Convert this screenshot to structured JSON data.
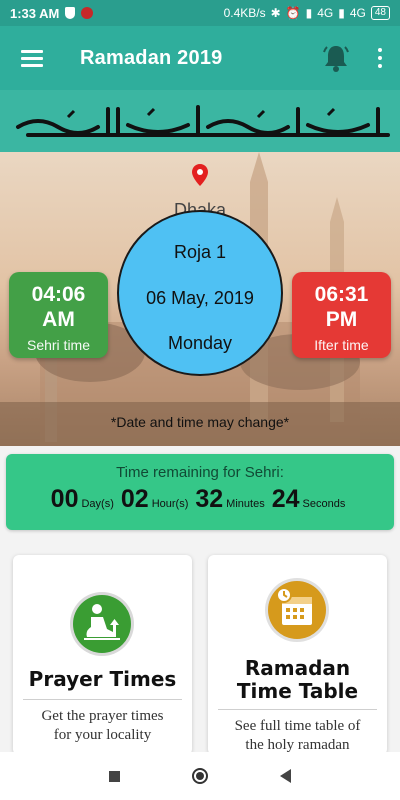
{
  "status_bar": {
    "time": "1:33 AM",
    "network_speed": "0.4KB/s",
    "network_1": "4G",
    "network_2": "4G",
    "battery": "48"
  },
  "app_bar": {
    "title": "Ramadan 2019",
    "icons": [
      "menu-icon",
      "bell-icon",
      "more-vert-icon"
    ]
  },
  "hero": {
    "location": "Dhaka",
    "sehri": {
      "time": "04:06",
      "ampm": "AM",
      "label": "Sehri time"
    },
    "ifter": {
      "time": "06:31",
      "ampm": "PM",
      "label": "Ifter time"
    },
    "date": {
      "roja": "Roja 1",
      "date": "06 May, 2019",
      "day": "Monday"
    },
    "disclaimer": "*Date and time may change*"
  },
  "countdown": {
    "label": "Time remaining for Sehri:",
    "days": "00",
    "days_unit": "Day(s)",
    "hours": "02",
    "hours_unit": "Hour(s)",
    "minutes": "32",
    "minutes_unit": "Minutes",
    "seconds": "24",
    "seconds_unit": "Seconds"
  },
  "cards": [
    {
      "title_1": "Prayer Times",
      "title_2": "",
      "desc_1": "Get the prayer times",
      "desc_2": "for your locality"
    },
    {
      "title_1": "Ramadan",
      "title_2": "Time Table",
      "desc_1": "See full time table of",
      "desc_2": "the holy ramadan"
    }
  ],
  "colors": {
    "primary": "#2fae9c",
    "sehri": "#43a047",
    "ifter": "#e53935",
    "circle": "#4fc1f3",
    "countdown": "#35c788"
  }
}
